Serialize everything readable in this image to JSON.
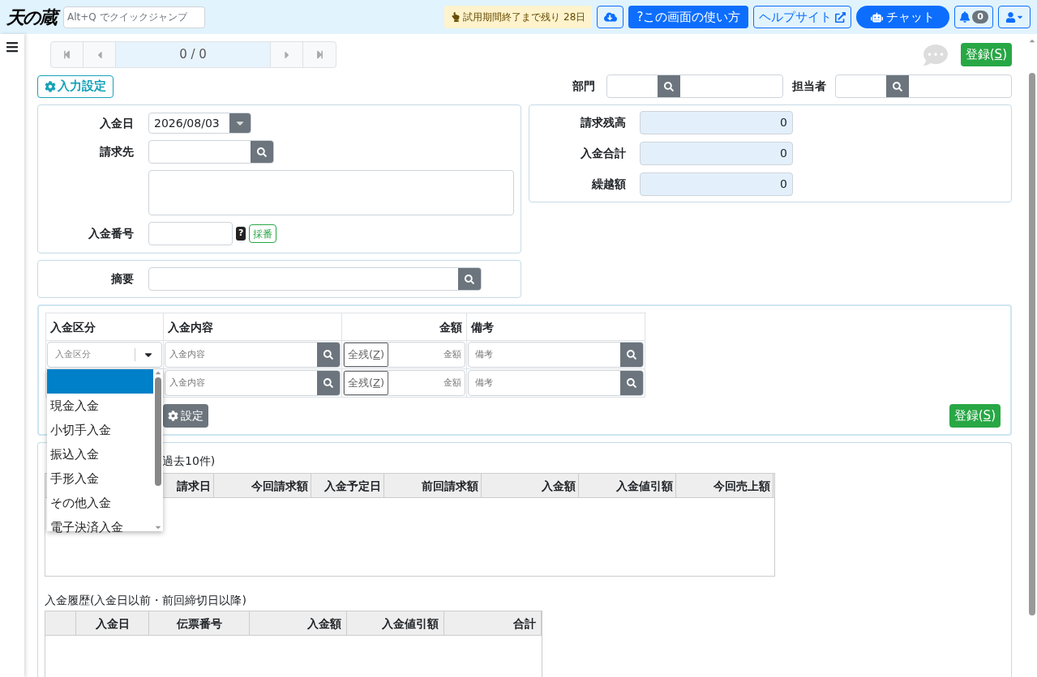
{
  "header": {
    "logo": "天の蔵",
    "quick_jump_placeholder": "Alt+Q でクイックジャンプ",
    "trial_notice": "試用期間終了まで残り 28日",
    "help_mark": "?",
    "help_button": "この画面の使い方",
    "help_site": "ヘルプサイト",
    "chat": "チャット",
    "notification_count": "0"
  },
  "pager": {
    "position": "0 / 0"
  },
  "register": {
    "prefix": "登録(",
    "key": "S",
    "suffix": ")"
  },
  "input_settings": "入力設定",
  "department": {
    "label": "部門"
  },
  "staff": {
    "label": "担当者"
  },
  "form": {
    "date_label": "入金日",
    "date_value": "2026/08/03",
    "billing_label": "請求先",
    "number_label": "入金番号",
    "number_help": "?",
    "assign_button": "採番"
  },
  "summary": [
    {
      "label": "請求残高",
      "value": "0"
    },
    {
      "label": "入金合計",
      "value": "0"
    },
    {
      "label": "繰越額",
      "value": "0"
    }
  ],
  "memo": {
    "label": "摘要"
  },
  "entry": {
    "columns": [
      "入金区分",
      "入金内容",
      "金額",
      "備考"
    ],
    "category_placeholder": "入金区分",
    "rows": [
      {
        "content_placeholder": "入金内容",
        "remaining": {
          "prefix": "全残(",
          "key": "Z",
          "suffix": ")"
        },
        "amount_placeholder": "金額",
        "note_placeholder": "備考"
      },
      {
        "content_placeholder": "入金内容",
        "remaining": {
          "prefix": "全残(",
          "key": "Z",
          "suffix": ")"
        },
        "amount_placeholder": "金額",
        "note_placeholder": "備考"
      }
    ],
    "settings_button": "設定",
    "register": {
      "prefix": "登録(",
      "key": "S",
      "suffix": ")"
    }
  },
  "dropdown": {
    "options": [
      {
        "selected": true
      },
      {
        "label": "現金入金",
        "selected": false
      },
      {
        "label": "小切手入金",
        "selected": false
      },
      {
        "label": "振込入金",
        "selected": false
      },
      {
        "label": "手形入金",
        "selected": false
      },
      {
        "label": "その他入金",
        "selected": false
      },
      {
        "label": "電子決済入金",
        "selected": false
      }
    ]
  },
  "history": {
    "title": "過去10件)",
    "columns": [
      "請求日",
      "今回請求額",
      "入金予定日",
      "前回請求額",
      "入金額",
      "入金値引額",
      "今回売上額"
    ]
  },
  "payment_history": {
    "title": "入金履歴(入金日以前・前回締切日以降)",
    "columns": [
      "入金日",
      "伝票番号",
      "入金額",
      "入金値引額",
      "合計"
    ]
  }
}
